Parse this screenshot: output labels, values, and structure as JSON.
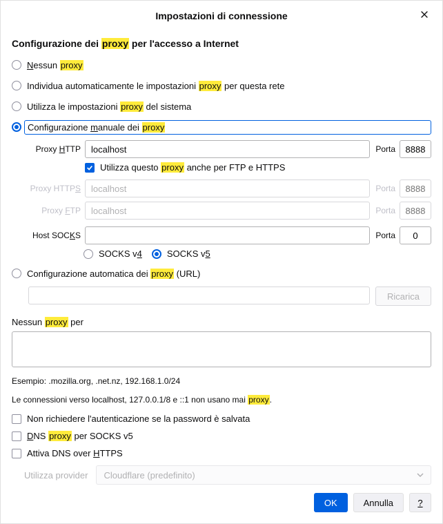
{
  "title": "Impostazioni di connessione",
  "section_heading": {
    "pre": "Configurazione dei ",
    "hl": "proxy",
    "post": " per l'accesso a Internet"
  },
  "options": {
    "none": {
      "pre_ul": "N",
      "pre": "essun ",
      "hl": "proxy"
    },
    "auto": {
      "pre": "Individua automaticamente le impostazioni ",
      "hl": "proxy",
      "post": " per questa rete"
    },
    "system": {
      "pre": "Utilizza le impostazioni ",
      "hl": "proxy",
      "post": " del sistema"
    },
    "manual": {
      "pre": "Configurazione ",
      "ul": "m",
      "mid": "anuale dei ",
      "hl": "proxy"
    },
    "pac": {
      "pre": "Configurazione automatica dei ",
      "hl": "proxy",
      "post": " (URL)"
    }
  },
  "fields": {
    "http": {
      "label_pre": "Proxy ",
      "label_ul": "H",
      "label_post": "TTP",
      "value": "localhost",
      "port_label": "Porta",
      "port": "8888"
    },
    "https": {
      "label": "Proxy HTTPS",
      "label_ul_char": "S",
      "placeholder": "localhost",
      "port_label": "Porta",
      "port_placeholder": "8888"
    },
    "ftp": {
      "label_pre": "Proxy ",
      "label_ul": "F",
      "label_post": "TP",
      "placeholder": "localhost",
      "port_label": "Porta",
      "port_placeholder": "8888"
    },
    "socks": {
      "label": "Host SOCKS",
      "label_ul_char": "K",
      "port_label": "Porta",
      "port": "0"
    }
  },
  "use_for_all": {
    "pre": "Utilizza questo ",
    "hl": "proxy",
    "post": " anche per FTP e HTTPS"
  },
  "socks_versions": {
    "v4_pre": "SOCKS v",
    "v4_ul": "4",
    "v5_pre": "SOCKS v",
    "v5_ul": "5"
  },
  "reload_label": "Ricarica",
  "noproxy": {
    "pre": "Nessun ",
    "hl": "proxy",
    "post": " per"
  },
  "example": "Esempio: .mozilla.org, .net.nz, 192.168.1.0/24",
  "localhost_note": {
    "pre": "Le connessioni verso localhost, 127.0.0.1/8 e ::1 non usano mai ",
    "hl": "proxy",
    "post": "."
  },
  "checks": {
    "noauth": "Non richiedere l'autenticazione se la password è salvata",
    "dns_socks": {
      "ul": "D",
      "pre": "NS ",
      "hl": "proxy",
      "post": " per SOCKS v5"
    },
    "doh": {
      "pre": "Attiva DNS over ",
      "ul": "H",
      "post": "TTPS"
    }
  },
  "provider": {
    "label": "Utilizza provider",
    "value": "Cloudflare (predefinito)"
  },
  "buttons": {
    "ok": "OK",
    "cancel": "Annulla",
    "help": "?"
  }
}
